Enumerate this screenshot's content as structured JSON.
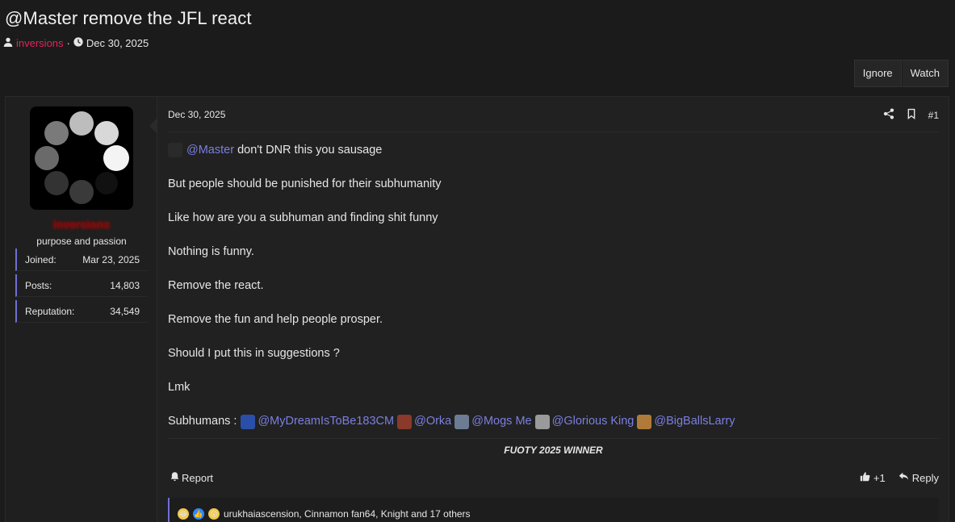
{
  "thread": {
    "title": "@Master remove the JFL react",
    "author": "inversions",
    "separator": "·",
    "date": "Dec 30, 2025"
  },
  "controls": {
    "ignore_label": "Ignore",
    "watch_label": "Watch"
  },
  "user": {
    "name": "inversions",
    "title": "purpose and passion",
    "stats": [
      {
        "label": "Joined:",
        "value": "Mar 23, 2025"
      },
      {
        "label": "Posts:",
        "value": "14,803"
      },
      {
        "label": "Reputation:",
        "value": "34,549"
      }
    ]
  },
  "post": {
    "date": "Dec 30, 2025",
    "number": "#1",
    "first_line_mention": "@Master",
    "first_line_rest": " don't DNR this you sausage",
    "lines": [
      "But people should be punished for their subhumanity",
      "Like how are you a subhuman and finding shit funny",
      "Nothing is funny.",
      "Remove the react.",
      "Remove the fun and help people prosper.",
      "Should I put this in suggestions ?",
      "Lmk"
    ],
    "subhumans_label": "Subhumans :",
    "mentions": [
      {
        "name": "@MyDreamIsToBe183CM",
        "color": "#2a4fa8"
      },
      {
        "name": "@Orka",
        "color": "#8a3a2a"
      },
      {
        "name": "@Mogs Me",
        "color": "#6b7c93"
      },
      {
        "name": "@Glorious King",
        "color": "#9a9a9a"
      },
      {
        "name": "@BigBallsLarry",
        "color": "#b07a3a"
      }
    ],
    "signature": "FUOTY 2025 WINNER"
  },
  "footer": {
    "report_label": "Report",
    "like_count": "+1",
    "reply_label": "Reply"
  },
  "reactions": {
    "text": "urukhaiascension, Cinnamon fan64, Knight and 17 others"
  },
  "colors": {
    "accent": "#6f6fd6",
    "author_link": "#e0245e",
    "mention": "#7b7fe0"
  }
}
